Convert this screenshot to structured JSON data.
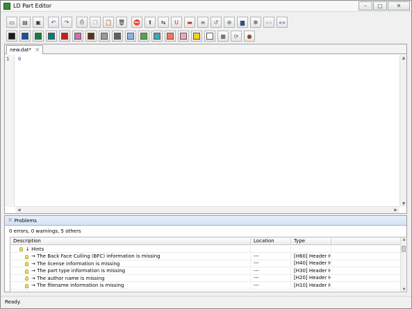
{
  "window": {
    "title": "LD Part Editor",
    "controls": {
      "minimize": "–",
      "maximize": "□",
      "close": "✕"
    }
  },
  "toolbar_row1": [
    {
      "name": "new-icon",
      "glyph": "▭",
      "enabled": true
    },
    {
      "name": "open-icon",
      "glyph": "▤",
      "enabled": true
    },
    {
      "name": "save-icon",
      "glyph": "▣",
      "enabled": true
    },
    {
      "sep": true
    },
    {
      "name": "undo-icon",
      "glyph": "↶",
      "enabled": true,
      "color": "#2a4fa8"
    },
    {
      "name": "redo-icon",
      "glyph": "↷",
      "enabled": true,
      "color": "#2a4fa8"
    },
    {
      "sep": true
    },
    {
      "name": "print-icon",
      "glyph": "⎙",
      "enabled": true
    },
    {
      "name": "copy-icon",
      "glyph": "❐",
      "enabled": false
    },
    {
      "name": "paste-icon",
      "glyph": "📋",
      "enabled": true
    },
    {
      "name": "delete-icon",
      "glyph": "🗑",
      "enabled": true
    },
    {
      "sep": true
    },
    {
      "name": "stop-icon",
      "glyph": "⛔",
      "enabled": true,
      "color": "#c02020"
    },
    {
      "name": "upload-icon",
      "glyph": "⬆",
      "enabled": true,
      "color": "#2f7a2f"
    },
    {
      "name": "mirror-icon",
      "glyph": "⇆",
      "enabled": true
    },
    {
      "name": "magnet-icon",
      "glyph": "U",
      "enabled": true,
      "color": "#b02030"
    },
    {
      "name": "ruler-icon",
      "glyph": "▬",
      "enabled": true,
      "color": "#c03030"
    },
    {
      "name": "align-icon",
      "glyph": "≡",
      "enabled": true,
      "color": "#2f7a2f"
    },
    {
      "name": "rotate-icon",
      "glyph": "↺",
      "enabled": true,
      "color": "#2f7a2f"
    },
    {
      "name": "lock-icon",
      "glyph": "⊕",
      "enabled": true,
      "color": "#2f7a2f"
    },
    {
      "name": "car-icon",
      "glyph": "▆",
      "enabled": true,
      "color": "#2a4f80"
    },
    {
      "name": "settings-icon",
      "glyph": "✻",
      "enabled": true
    },
    {
      "name": "abc-icon",
      "glyph": "«»",
      "enabled": false
    },
    {
      "name": "code-icon",
      "glyph": "«»",
      "enabled": true,
      "color": "#2a4fa8"
    }
  ],
  "toolbar_row2": {
    "colors": [
      "#1b1b1b",
      "#1c4fa8",
      "#1f7a3a",
      "#0a7a7a",
      "#c81e1e",
      "#d070b0",
      "#5a3414",
      "#9a9a9a",
      "#606060",
      "#8ab4e0",
      "#4caa46",
      "#3fa8b0",
      "#f07860",
      "#f4a0c8",
      "#f4d21e",
      "#ffffff"
    ],
    "after": [
      {
        "name": "color-gray-button",
        "glyph": "■",
        "color": "#787878"
      },
      {
        "name": "refresh-icon",
        "glyph": "⟳",
        "color": "#2f7a2f"
      },
      {
        "name": "palette-icon",
        "glyph": "●",
        "color": "#8a4a20"
      }
    ]
  },
  "editor": {
    "tab_label": "new.dat*",
    "tab_close": "⨉",
    "line_numbers": [
      "1"
    ],
    "lines": [
      "0"
    ]
  },
  "problems": {
    "title": "Problems",
    "close_glyph": "⨉",
    "summary": "0 errors, 0 warnings, 5 others",
    "columns": [
      "Description",
      "Location",
      "Type"
    ],
    "rows": [
      {
        "desc": "↓ Hints",
        "loc": "",
        "type": "",
        "group": true
      },
      {
        "desc": "→ The Back Face Culling (BFC) information is missing",
        "loc": "---",
        "type": "[H60] Header H..."
      },
      {
        "desc": "→ The license information is missing",
        "loc": "---",
        "type": "[H40] Header H..."
      },
      {
        "desc": "→ The part type information is missing",
        "loc": "---",
        "type": "[H30] Header H..."
      },
      {
        "desc": "→ The author name is missing",
        "loc": "---",
        "type": "[H20] Header H..."
      },
      {
        "desc": "→ The filename information is missing",
        "loc": "---",
        "type": "[H10] Header H..."
      }
    ]
  },
  "status": {
    "text": "Ready."
  }
}
